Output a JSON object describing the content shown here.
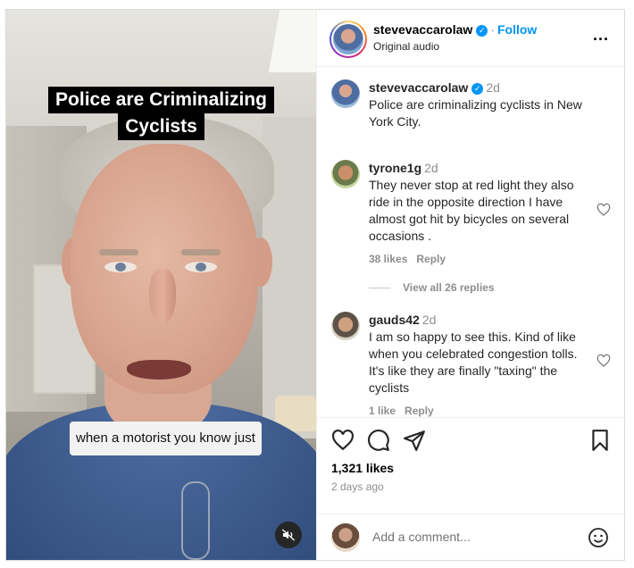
{
  "video": {
    "title_line1": "Police are Criminalizing",
    "title_line2": "Cyclists",
    "caption": "when a motorist you know just",
    "mute_icon": "muted-speaker-icon"
  },
  "header": {
    "username": "stevevaccarolaw",
    "verified": true,
    "separator": "·",
    "follow_label": "Follow",
    "audio_label": "Original audio",
    "more_label": "..."
  },
  "post_caption": {
    "username": "stevevaccarolaw",
    "time": "2d",
    "text": "Police are criminalizing cyclists in New York City."
  },
  "comments": [
    {
      "username": "tyrone1g",
      "time": "2d",
      "text": "They never stop at red light they also ride in the opposite direction I have almost got hit by bicycles on several occasions .",
      "likes": "38 likes",
      "reply_label": "Reply"
    },
    {
      "username": "gauds42",
      "time": "2d",
      "text": "I am so happy to see this. Kind of like when you celebrated congestion tolls. It's like they are finally \"taxing\" the cyclists",
      "likes": "1 like",
      "reply_label": "Reply"
    }
  ],
  "view_replies": "View all 26 replies",
  "actions": {
    "like_icon": "heart-icon",
    "comment_icon": "comment-icon",
    "share_icon": "send-icon",
    "save_icon": "bookmark-icon",
    "likes": "1,321 likes",
    "date": "2 days ago"
  },
  "add_comment": {
    "placeholder": "Add a comment...",
    "emoji_icon": "emoji-icon"
  },
  "colors": {
    "accent": "#0095f6",
    "muted_text": "#8e8e8e",
    "border": "#dbdbdb"
  }
}
